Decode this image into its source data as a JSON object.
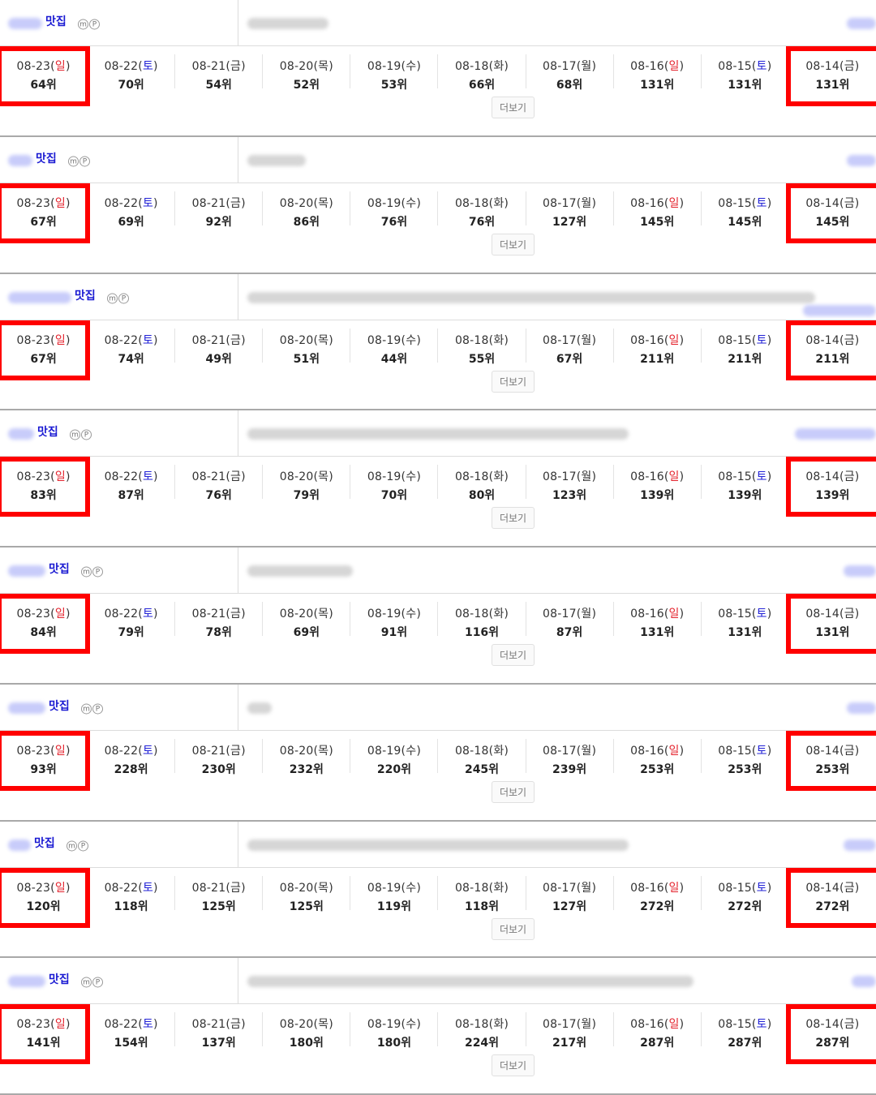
{
  "more_label": "더보기",
  "keyword_suffix": "맛집",
  "mobile_badge": "m",
  "pc_badge": "P",
  "colors": {
    "sunday": "#e4232d",
    "saturday": "#2222d6",
    "highlight": "#ff0000"
  },
  "dates": [
    {
      "date": "08-23",
      "day": "일",
      "kind": "sun"
    },
    {
      "date": "08-22",
      "day": "토",
      "kind": "sat"
    },
    {
      "date": "08-21",
      "day": "금",
      "kind": "wk"
    },
    {
      "date": "08-20",
      "day": "목",
      "kind": "wk"
    },
    {
      "date": "08-19",
      "day": "수",
      "kind": "wk"
    },
    {
      "date": "08-18",
      "day": "화",
      "kind": "wk"
    },
    {
      "date": "08-17",
      "day": "월",
      "kind": "wk"
    },
    {
      "date": "08-16",
      "day": "일",
      "kind": "sun"
    },
    {
      "date": "08-15",
      "day": "토",
      "kind": "sat"
    },
    {
      "date": "08-14",
      "day": "금",
      "kind": "wk"
    }
  ],
  "blocks": [
    {
      "ranks": [
        "64위",
        "70위",
        "54위",
        "52위",
        "53위",
        "66위",
        "68위",
        "131위",
        "131위",
        "131위"
      ]
    },
    {
      "ranks": [
        "67위",
        "69위",
        "92위",
        "86위",
        "76위",
        "76위",
        "127위",
        "145위",
        "145위",
        "145위"
      ]
    },
    {
      "ranks": [
        "67위",
        "74위",
        "49위",
        "51위",
        "44위",
        "55위",
        "67위",
        "211위",
        "211위",
        "211위"
      ]
    },
    {
      "ranks": [
        "83위",
        "87위",
        "76위",
        "79위",
        "70위",
        "80위",
        "123위",
        "139위",
        "139위",
        "139위"
      ]
    },
    {
      "ranks": [
        "84위",
        "79위",
        "78위",
        "69위",
        "91위",
        "116위",
        "87위",
        "131위",
        "131위",
        "131위"
      ]
    },
    {
      "ranks": [
        "93위",
        "228위",
        "230위",
        "232위",
        "220위",
        "245위",
        "239위",
        "253위",
        "253위",
        "253위"
      ]
    },
    {
      "ranks": [
        "120위",
        "118위",
        "125위",
        "125위",
        "119위",
        "118위",
        "127위",
        "272위",
        "272위",
        "272위"
      ]
    },
    {
      "ranks": [
        "141위",
        "154위",
        "137위",
        "180위",
        "180위",
        "224위",
        "217위",
        "287위",
        "287위",
        "287위"
      ]
    }
  ]
}
